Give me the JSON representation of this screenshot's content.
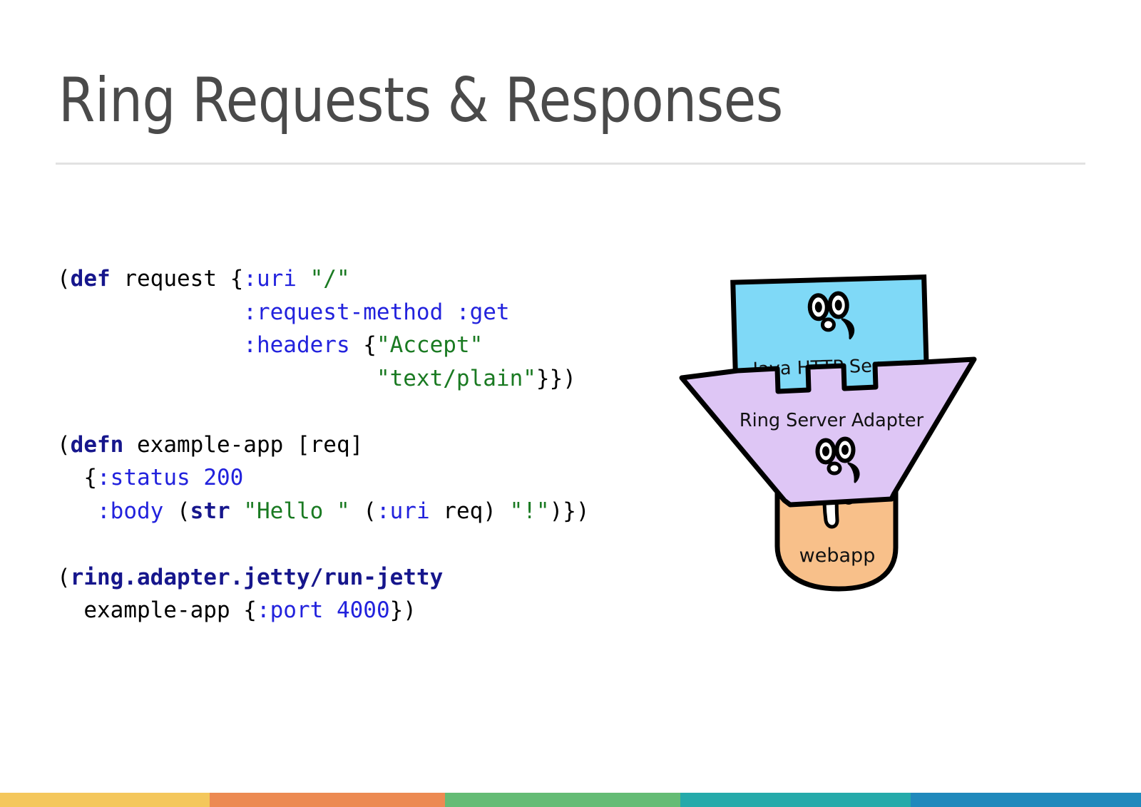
{
  "slide": {
    "title": "Ring Requests & Responses",
    "background_color": "#ffffff",
    "title_color": "#4a4a4a",
    "rule_color": "#e2e2e2"
  },
  "code_block": {
    "language": "clojure",
    "font": "monospace",
    "colors": {
      "default": "#000000",
      "definition_keyword": "#16168c",
      "keyword_literal": "#2222dd",
      "number": "#2222dd",
      "string": "#1a7a22"
    },
    "lines": [
      {
        "id": "line-1",
        "text": "(def request {:uri \"/\"",
        "tokens": [
          {
            "t": "(",
            "c": "plain"
          },
          {
            "t": "def",
            "c": "kw"
          },
          {
            "t": " request {",
            "c": "plain"
          },
          {
            "t": ":uri",
            "c": "key"
          },
          {
            "t": " ",
            "c": "plain"
          },
          {
            "t": "\"/\"",
            "c": "str"
          }
        ]
      },
      {
        "id": "line-2",
        "text": "              :request-method :get",
        "tokens": [
          {
            "t": "              ",
            "c": "plain"
          },
          {
            "t": ":request-method :get",
            "c": "key"
          }
        ]
      },
      {
        "id": "line-3",
        "text": "              :headers {\"Accept\"",
        "tokens": [
          {
            "t": "              ",
            "c": "plain"
          },
          {
            "t": ":headers",
            "c": "key"
          },
          {
            "t": " {",
            "c": "plain"
          },
          {
            "t": "\"Accept\"",
            "c": "str"
          }
        ]
      },
      {
        "id": "line-4",
        "text": "                        \"text/plain\"}})",
        "tokens": [
          {
            "t": "                        ",
            "c": "plain"
          },
          {
            "t": "\"text/plain\"",
            "c": "str"
          },
          {
            "t": "}})",
            "c": "plain"
          }
        ]
      },
      {
        "id": "line-5",
        "text": "",
        "tokens": []
      },
      {
        "id": "line-6",
        "text": "(defn example-app [req]",
        "tokens": [
          {
            "t": "(",
            "c": "plain"
          },
          {
            "t": "defn",
            "c": "kw"
          },
          {
            "t": " example-app [req]",
            "c": "plain"
          }
        ]
      },
      {
        "id": "line-7",
        "text": "  {:status 200",
        "tokens": [
          {
            "t": "  {",
            "c": "plain"
          },
          {
            "t": ":status",
            "c": "key"
          },
          {
            "t": " ",
            "c": "plain"
          },
          {
            "t": "200",
            "c": "num"
          }
        ]
      },
      {
        "id": "line-8",
        "text": "   :body (str \"Hello \" (:uri req) \"!\")})",
        "tokens": [
          {
            "t": "   ",
            "c": "plain"
          },
          {
            "t": ":body",
            "c": "key"
          },
          {
            "t": " (",
            "c": "plain"
          },
          {
            "t": "str",
            "c": "kw"
          },
          {
            "t": " ",
            "c": "plain"
          },
          {
            "t": "\"Hello \"",
            "c": "str"
          },
          {
            "t": " (",
            "c": "plain"
          },
          {
            "t": ":uri",
            "c": "key"
          },
          {
            "t": " req) ",
            "c": "plain"
          },
          {
            "t": "\"!\"",
            "c": "str"
          },
          {
            "t": ")})",
            "c": "plain"
          }
        ]
      },
      {
        "id": "line-9",
        "text": "",
        "tokens": []
      },
      {
        "id": "line-10",
        "text": "(ring.adapter.jetty/run-jetty",
        "tokens": [
          {
            "t": "(",
            "c": "plain"
          },
          {
            "t": "ring.adapter.jetty/run-jetty",
            "c": "kw"
          }
        ]
      },
      {
        "id": "line-11",
        "text": "  example-app {:port 4000})",
        "tokens": [
          {
            "t": "  example-app {",
            "c": "plain"
          },
          {
            "t": ":port",
            "c": "key"
          },
          {
            "t": " ",
            "c": "plain"
          },
          {
            "t": "4000",
            "c": "num"
          },
          {
            "t": "})",
            "c": "plain"
          }
        ]
      }
    ]
  },
  "diagram": {
    "name": "ring-architecture-cartoon",
    "layers": [
      {
        "id": "java-http-server",
        "label": "Java HTTP Server",
        "shape": "rectangle",
        "fill": "#7fd9f7",
        "stroke": "#000000",
        "has_face": true
      },
      {
        "id": "ring-server-adapter",
        "label": "Ring Server Adapter",
        "shape": "funnel-with-teeth",
        "fill": "#dec6f5",
        "stroke": "#000000",
        "has_face": true
      },
      {
        "id": "webapp",
        "label": "webapp",
        "shape": "rounded-blob",
        "fill": "#f8c08a",
        "stroke": "#000000",
        "has_face": true
      }
    ]
  },
  "bottom_bar": {
    "segments": [
      {
        "name": "yellow",
        "color": "#f4c75c",
        "width_pct": 18.4
      },
      {
        "name": "orange",
        "color": "#ec8a52",
        "width_pct": 20.6
      },
      {
        "name": "green",
        "color": "#64bc75",
        "width_pct": 20.6
      },
      {
        "name": "teal",
        "color": "#25aaaa",
        "width_pct": 20.2
      },
      {
        "name": "blue",
        "color": "#2089bc",
        "width_pct": 20.2
      }
    ]
  }
}
